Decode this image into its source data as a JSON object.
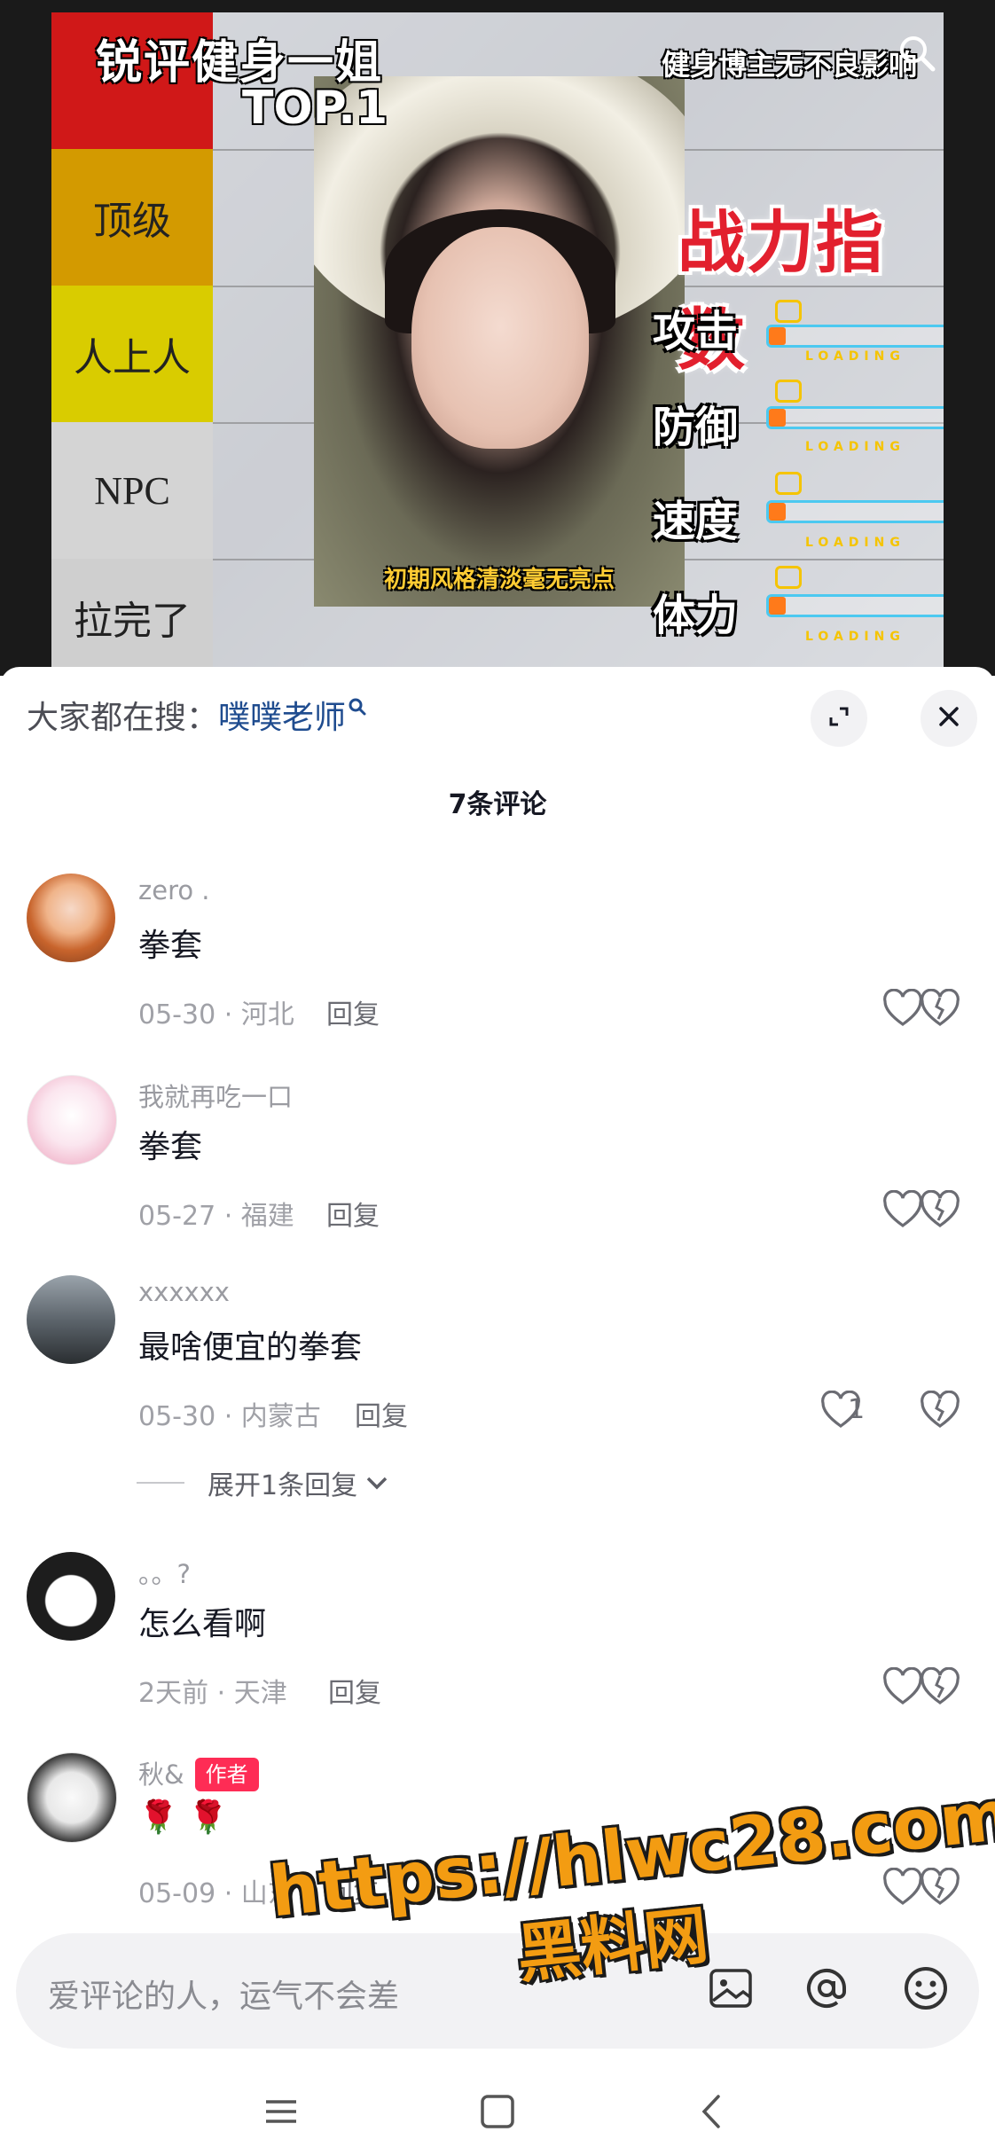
{
  "video": {
    "title_line1": "锐评健身一姐",
    "title_line2": "TOP.1",
    "corner_note": "健身博主无不良影响",
    "tiers": [
      {
        "label": "",
        "color": "#d01818"
      },
      {
        "label": "顶级",
        "color": "#d39a00"
      },
      {
        "label": "人上人",
        "color": "#d9cc00"
      },
      {
        "label": "NPC",
        "color": "#d4d4d4"
      },
      {
        "label": "拉完了",
        "color": "#cfcfcf"
      }
    ],
    "photo_caption": "初期风格清淡毫无亮点",
    "power_title": "战力指数",
    "stats": [
      {
        "label": "攻击",
        "loading": "LOADING"
      },
      {
        "label": "防御",
        "loading": "LOADING"
      },
      {
        "label": "速度",
        "loading": "LOADING"
      },
      {
        "label": "体力",
        "loading": "LOADING"
      }
    ]
  },
  "search": {
    "prefix": "大家都在搜：",
    "hot_term": "噗噗老师"
  },
  "comment_count_title": "7条评论",
  "comments": [
    {
      "user": "zero .",
      "text": "拳套",
      "date": "05-30",
      "location": "河北",
      "reply": "回复",
      "likes": "",
      "avatar": "anime-orange"
    },
    {
      "user": "我就再吃一口",
      "text": "拳套",
      "date": "05-27",
      "location": "福建",
      "reply": "回复",
      "likes": "",
      "avatar": "anime-pink"
    },
    {
      "user": "xxxxxx",
      "text": "最啥便宜的拳套",
      "date": "05-30",
      "location": "内蒙古",
      "reply": "回复",
      "likes": "1",
      "avatar": "silhouette"
    },
    {
      "user": "。。?",
      "text": "怎么看啊",
      "date": "2天前",
      "location": "天津",
      "reply": "回复",
      "likes": "",
      "avatar": "cartoon-face"
    },
    {
      "user": "秋&",
      "text": "🌹 🌹",
      "date": "05-09",
      "location": "山东",
      "reply": "回复",
      "likes": "",
      "avatar": "manga-girl",
      "badge": "作者"
    }
  ],
  "meta_separator": " · ",
  "expand_replies": "展开1条回复",
  "input": {
    "placeholder": "爱评论的人，运气不会差"
  },
  "watermark": {
    "url": "https://hlwc28.com",
    "name": "黑料网"
  },
  "colors": {
    "accent_red": "#fe2c55",
    "hot_search_blue": "#1f4c8f"
  }
}
